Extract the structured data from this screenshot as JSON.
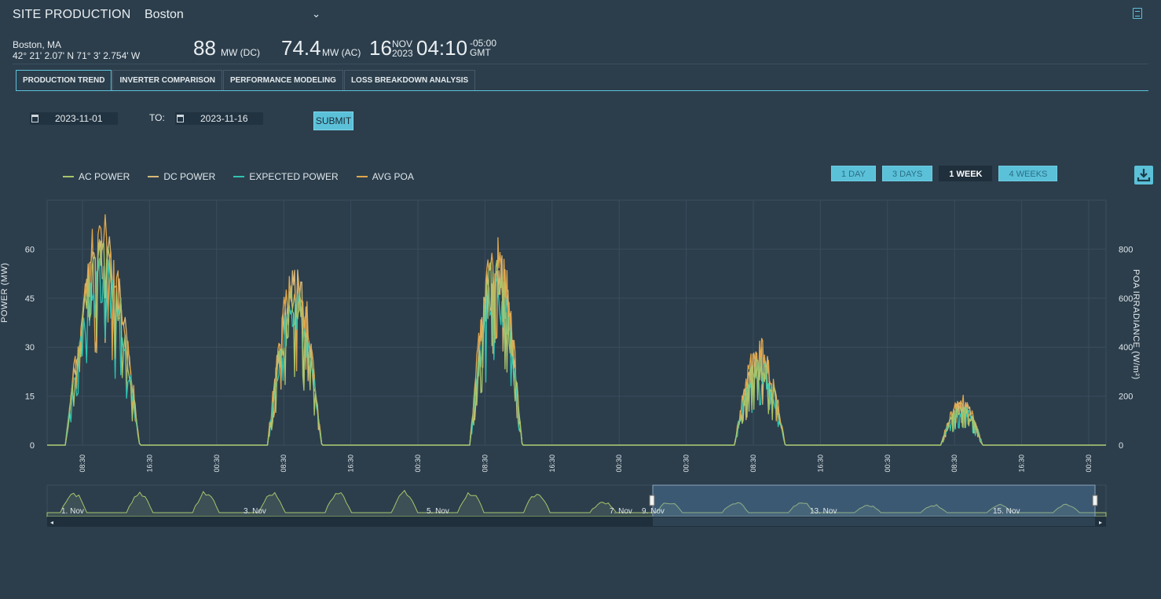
{
  "header": {
    "title": "SITE PRODUCTION",
    "site": "Boston"
  },
  "site_info": {
    "city": "Boston, MA",
    "coords": "42° 21' 2.07' N 71° 3' 2.754' W",
    "dc_value": "88",
    "dc_unit": "MW (DC)",
    "ac_value": "74.4",
    "ac_unit": "MW (AC)",
    "day": "16",
    "month": "NOV",
    "year": "2023",
    "time": "04:10",
    "tz_offset": "-05:00",
    "tz_name": "GMT"
  },
  "tabs": [
    {
      "label": "PRODUCTION TREND",
      "active": true
    },
    {
      "label": "INVERTER COMPARISON",
      "active": false
    },
    {
      "label": "PERFORMANCE MODELING",
      "active": false
    },
    {
      "label": "LOSS BREAKDOWN ANALYSIS",
      "active": false
    }
  ],
  "filters": {
    "from": "2023-11-01",
    "to_label": "TO:",
    "to": "2023-11-16",
    "submit": "SUBMIT"
  },
  "range_buttons": [
    {
      "label": "1 DAY",
      "active": false
    },
    {
      "label": "3 DAYS",
      "active": false
    },
    {
      "label": "1 WEEK",
      "active": true
    },
    {
      "label": "4 WEEKS",
      "active": false
    }
  ],
  "colors": {
    "ac": "#a9c46a",
    "dc": "#d9b878",
    "expected": "#2fc4b2",
    "poa": "#e0a64c",
    "accent": "#5bc1d9"
  },
  "chart_data": {
    "type": "line",
    "legend": [
      "AC POWER",
      "DC POWER",
      "EXPECTED POWER",
      "AVG POA"
    ],
    "ylabel": "POWER (MW)",
    "ylabel_right": "POA IRRADIANCE (W/m²)",
    "ylim": [
      0,
      75
    ],
    "ylim_right": [
      0,
      1000
    ],
    "yticks": [
      0,
      15,
      30,
      45,
      60
    ],
    "yticks_right": [
      0,
      200,
      400,
      600,
      800
    ],
    "x_ticks": [
      "08:30",
      "16:30",
      "00:30",
      "08:30",
      "16:30",
      "00:30",
      "08:30",
      "16:30",
      "00:30",
      "00:30",
      "08:30",
      "16:30",
      "00:30",
      "08:30",
      "16:30",
      "00:30"
    ],
    "days": [
      {
        "start": 0.09,
        "end": 0.515,
        "peak": 62
      },
      {
        "start": 0.095,
        "end": 0.405,
        "peak": 50
      },
      {
        "start": 0.1,
        "end": 0.4,
        "peak": 58
      },
      {
        "start": 0.095,
        "end": 0.385,
        "peak": 28
      },
      {
        "start": 0.12,
        "end": 0.36,
        "peak": 13
      }
    ],
    "navigator": {
      "labels": [
        "1. Nov",
        "3. Nov",
        "5. Nov",
        "7. Nov",
        "9. Nov",
        "13. Nov",
        "15. Nov"
      ]
    }
  }
}
